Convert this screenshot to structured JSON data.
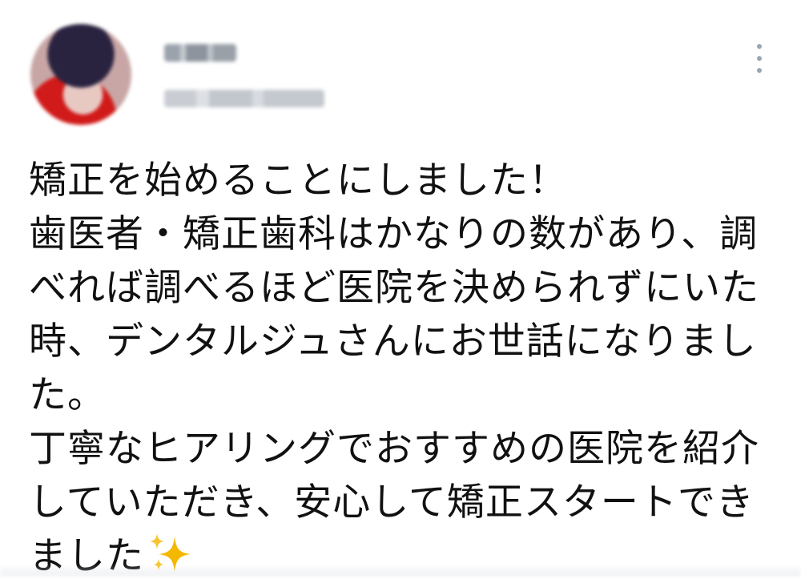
{
  "tweet": {
    "lines": [
      "矯正を始めることにしました！",
      "歯医者・矯正歯科はかなりの数があり、調",
      "べれば調べるほど医院を決められずにいた",
      "時、デンタルジュさんにお世話になりまし",
      "た。",
      "丁寧なヒアリングでおすすめの医院を紹介",
      "していただき、安心して矯正スタートでき",
      "ました"
    ],
    "emoji": "sparkles-icon"
  },
  "colors": {
    "text": "#111111",
    "menu_dots": "#9aa6b2",
    "sparkle": "#f5b800"
  }
}
